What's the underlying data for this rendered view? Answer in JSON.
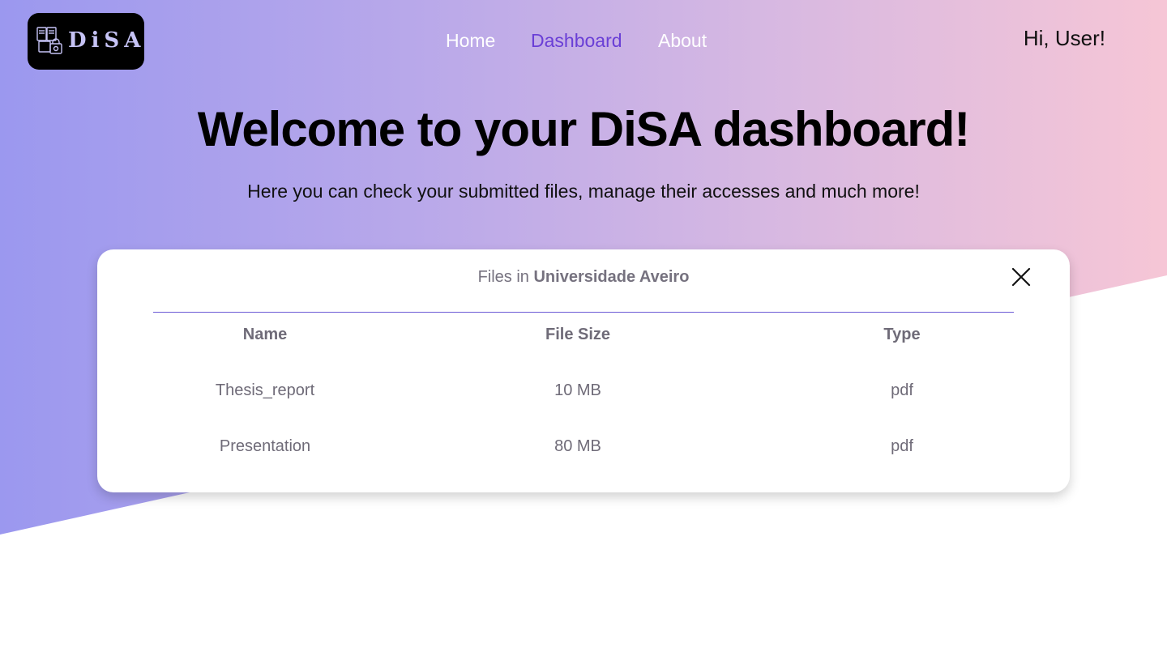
{
  "logo": {
    "text": "DiSA"
  },
  "nav": {
    "home": "Home",
    "dashboard": "Dashboard",
    "about": "About"
  },
  "user": {
    "greeting": "Hi, User!"
  },
  "hero": {
    "title": "Welcome to your DiSA dashboard!",
    "subtitle": "Here you can check your submitted files, manage their accesses and much more!"
  },
  "card": {
    "prefix": "Files in ",
    "org": "Universidade Aveiro",
    "columns": [
      "Name",
      "File Size",
      "Type"
    ],
    "rows": [
      [
        "Thesis_report",
        "10 MB",
        "pdf"
      ],
      [
        "Presentation",
        "80 MB",
        "pdf"
      ]
    ]
  },
  "colors": {
    "gradient_start": "#9b98ef",
    "gradient_end": "#f6c6d6",
    "active_nav": "#6a3fd6",
    "divider": "#6b5ad6"
  },
  "icons": {
    "logo": "document-lock-icon",
    "close": "close-icon"
  }
}
